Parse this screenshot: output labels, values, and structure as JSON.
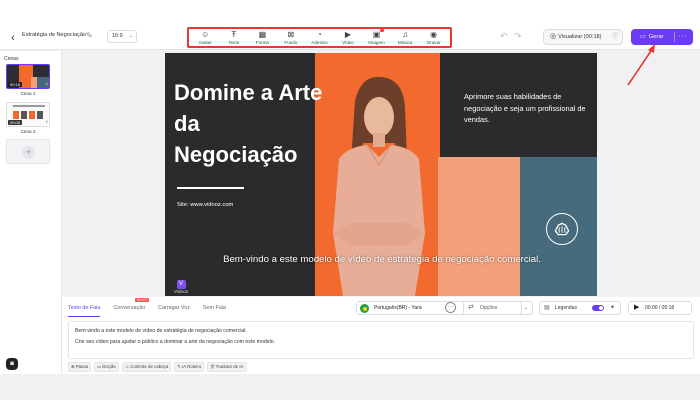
{
  "header": {
    "project_title": "Estratégia de Negociação",
    "aspect_ratio": "16:9",
    "tools": [
      {
        "label": "Avatar",
        "icon": "user-circle-icon",
        "glyph": "☺"
      },
      {
        "label": "Texto",
        "icon": "text-icon",
        "glyph": "Ŧ"
      },
      {
        "label": "Forma",
        "icon": "shapes-icon",
        "glyph": "▦"
      },
      {
        "label": "Fundo",
        "icon": "background-icon",
        "glyph": "⊠"
      },
      {
        "label": "Adesivo",
        "icon": "sticker-icon",
        "glyph": "◔"
      },
      {
        "label": "Vídeo",
        "icon": "video-icon",
        "glyph": "▶"
      },
      {
        "label": "Imagem",
        "icon": "image-icon",
        "glyph": "▣"
      },
      {
        "label": "Música",
        "icon": "music-icon",
        "glyph": "♫"
      },
      {
        "label": "Gravar",
        "icon": "record-icon",
        "glyph": "◉"
      }
    ],
    "preview_label": "Visualizar (00:18)",
    "generate_label": "Gerar",
    "accent_color": "#6c3cf4"
  },
  "scenes": {
    "title": "Cenas",
    "items": [
      {
        "label": "Cena 1",
        "duration": "00:18"
      },
      {
        "label": "Cena 2",
        "duration": "00:08"
      }
    ]
  },
  "canvas": {
    "heading": "Domine a Arte da Negociação",
    "site": "Site: www.vidnoz.com",
    "tagline": "Aprimore suas habilidades de negociação e seja um profissional de vendas.",
    "caption": "Bem-vindo a este modelo de vídeo de estratégia de negociação comercial.",
    "logo_text": "Vidnoz",
    "colors": {
      "dark": "#2b2b2d",
      "orange": "#f26a2d",
      "peach": "#f4a07a",
      "blue": "#466b7c"
    }
  },
  "panel": {
    "tabs": [
      {
        "label": "Texto de Fala",
        "active": true
      },
      {
        "label": "Conversação",
        "badge": "NOVO"
      },
      {
        "label": "Carregar Voz"
      },
      {
        "label": "Sem Fala"
      }
    ],
    "voice": "Português(BR) - Yara",
    "options_label": "Opções",
    "subtitles_label": "Legendas",
    "time": "00:00 / 00:18",
    "script_lines": [
      "Bem-vindo a este modelo de vídeo de estratégia de negociação comercial.",
      "Crie seu vídeo para ajudar o público a dominar a arte da negociação com este modelo."
    ],
    "chips": [
      {
        "label": "Pausa",
        "icon": "pause-icon",
        "glyph": "⊕"
      },
      {
        "label": "Dicção",
        "icon": "diction-icon",
        "glyph": "▭"
      },
      {
        "label": "Controle de cabeça",
        "icon": "head-control-icon",
        "glyph": "☺"
      },
      {
        "label": "IA Roteiro",
        "icon": "ai-script-icon",
        "glyph": "✎"
      },
      {
        "label": "Tradutor de IA",
        "icon": "ai-translator-icon",
        "glyph": "文"
      }
    ]
  }
}
